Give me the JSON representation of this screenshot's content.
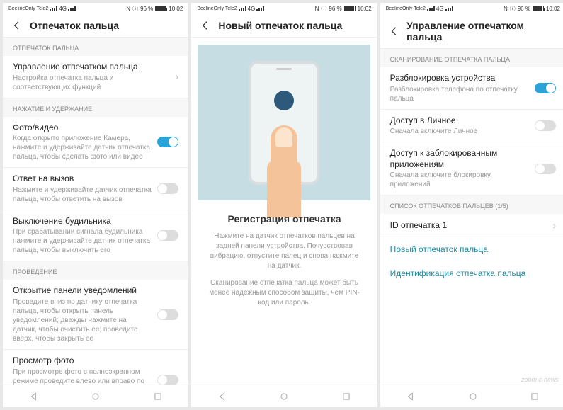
{
  "status": {
    "carrier": "BeelineOnly\nTele2",
    "nfc": "N",
    "battery": "96 %",
    "time": "10:02"
  },
  "p1": {
    "title": "Отпечаток пальца",
    "s1": "ОТПЕЧАТОК ПАЛЬЦА",
    "r1t": "Управление отпечатком пальца",
    "r1s": "Настройка отпечатка пальца и соответствующих функций",
    "s2": "НАЖАТИЕ И УДЕРЖАНИЕ",
    "r2t": "Фото/видео",
    "r2s": "Когда открыто приложение Камера, нажмите и удерживайте датчик отпечатка пальца, чтобы сделать фото или видео",
    "r3t": "Ответ на вызов",
    "r3s": "Нажмите и удерживайте датчик отпечатка пальца, чтобы ответить на вызов",
    "r4t": "Выключение будильника",
    "r4s": "При срабатывании сигнала будильника нажмите и удерживайте датчик отпечатка пальца, чтобы выключить его",
    "s3": "ПРОВЕДЕНИЕ",
    "r5t": "Открытие панели уведомлений",
    "r5s": "Проведите вниз по датчику отпечатка пальца, чтобы открыть панель уведомлений; дважды нажмите на датчик, чтобы очистить ее; проведите вверх, чтобы закрыть ее",
    "r6t": "Просмотр фото",
    "r6s": "При просмотре фото в полноэкранном режиме проведите влево или вправо по датчику отпечатка пальца, чтобы перейти к предыдущему или следующему фото"
  },
  "p2": {
    "title": "Новый отпечаток пальца",
    "regTitle": "Регистрация отпечатка",
    "text1": "Нажмите на датчик отпечатков пальцев на задней панели устройства. Почувствовав вибрацию, отпустите палец и снова нажмите на датчик.",
    "text2": "Сканирование отпечатка пальца может быть менее надежным способом защиты, чем PIN-код или пароль."
  },
  "p3": {
    "title": "Управление отпечатком пальца",
    "s1": "СКАНИРОВАНИЕ ОТПЕЧАТКА ПАЛЬЦА",
    "r1t": "Разблокировка устройства",
    "r1s": "Разблокировка телефона по отпечатку пальца",
    "r2t": "Доступ в Личное",
    "r2s": "Сначала включите Личное",
    "r3t": "Доступ к заблокированным приложениям",
    "r3s": "Сначала включите блокировку приложений",
    "s2": "СПИСОК ОТПЕЧАТКОВ ПАЛЬЦЕВ (1/5)",
    "r4t": "ID отпечатка 1",
    "link1": "Новый отпечаток пальца",
    "link2": "Идентификация отпечатка пальца"
  },
  "watermark": "zoom\nc-news"
}
